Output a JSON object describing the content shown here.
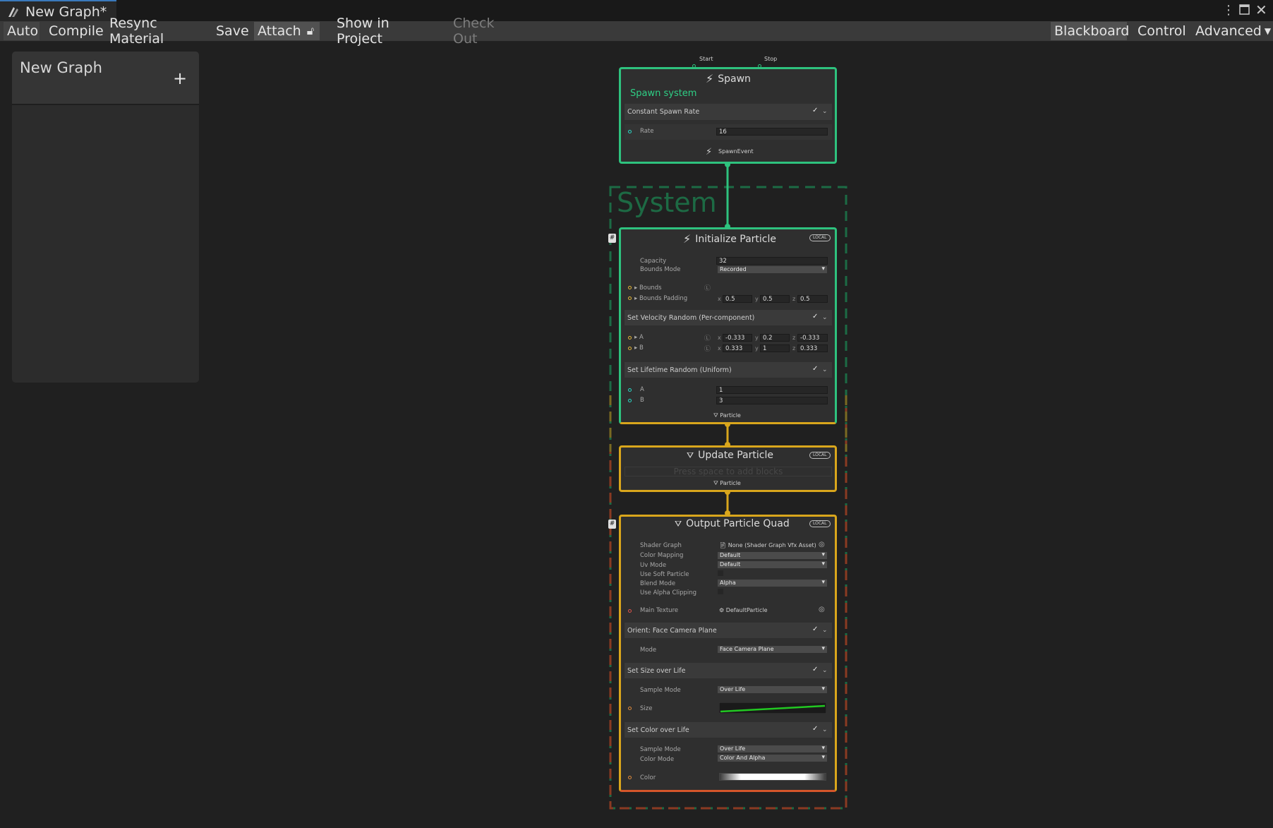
{
  "window": {
    "tab_title": "New Graph*"
  },
  "toolbar": {
    "auto": "Auto",
    "compile": "Compile",
    "resync": "Resync Material",
    "save": "Save",
    "attach": "Attach",
    "show_in_project": "Show in Project",
    "check_out": "Check Out",
    "blackboard": "Blackboard",
    "control": "Control",
    "advanced": "Advanced"
  },
  "blackboard": {
    "title": "New Graph"
  },
  "spawn": {
    "port_start": "Start",
    "port_stop": "Stop",
    "title": "Spawn",
    "subtitle": "Spawn system",
    "block_title": "Constant Spawn Rate",
    "rate_label": "Rate",
    "rate_value": "16",
    "event": "SpawnEvent"
  },
  "system_label": "System",
  "init": {
    "title": "Initialize Particle",
    "badge": "LOCAL",
    "capacity_label": "Capacity",
    "capacity_value": "32",
    "bounds_mode_label": "Bounds Mode",
    "bounds_mode_value": "Recorded",
    "bounds_label": "Bounds",
    "bounds_padding_label": "Bounds Padding",
    "pad_x": "0.5",
    "pad_y": "0.5",
    "pad_z": "0.5",
    "velocity_title": "Set Velocity Random (Per-component)",
    "a_label": "A",
    "b_label": "B",
    "vel_a_x": "-0.333",
    "vel_a_y": "0.2",
    "vel_a_z": "-0.333",
    "vel_b_x": "0.333",
    "vel_b_y": "1",
    "vel_b_z": "0.333",
    "lifetime_title": "Set Lifetime Random (Uniform)",
    "life_a": "1",
    "life_b": "3",
    "flow_out": "Particle"
  },
  "update": {
    "title": "Update Particle",
    "badge": "LOCAL",
    "placeholder": "Press space to add blocks",
    "flow_out": "Particle"
  },
  "output": {
    "title": "Output Particle Quad",
    "badge": "LOCAL",
    "shader_graph_label": "Shader Graph",
    "shader_graph_value": "None (Shader Graph Vfx Asset)",
    "color_mapping_label": "Color Mapping",
    "color_mapping_value": "Default",
    "uv_mode_label": "Uv Mode",
    "uv_mode_value": "Default",
    "soft_particle_label": "Use Soft Particle",
    "blend_mode_label": "Blend Mode",
    "blend_mode_value": "Alpha",
    "alpha_clip_label": "Use Alpha Clipping",
    "main_texture_label": "Main Texture",
    "main_texture_value": "DefaultParticle",
    "orient_title": "Orient: Face Camera Plane",
    "mode_label": "Mode",
    "mode_value": "Face Camera Plane",
    "size_title": "Set Size over Life",
    "sample_mode_label": "Sample Mode",
    "sample_mode_value": "Over Life",
    "size_label": "Size",
    "color_title": "Set Color over Life",
    "color_sample_mode_label": "Sample Mode",
    "color_sample_mode_value": "Over Life",
    "color_mode_label": "Color Mode",
    "color_mode_value": "Color And Alpha",
    "color_label": "Color"
  },
  "colors": {
    "spawn_green": "#2ec27e",
    "particle_yellow": "#d9a61c",
    "output_red": "#d5552a",
    "system_border": "#1c6b45"
  }
}
